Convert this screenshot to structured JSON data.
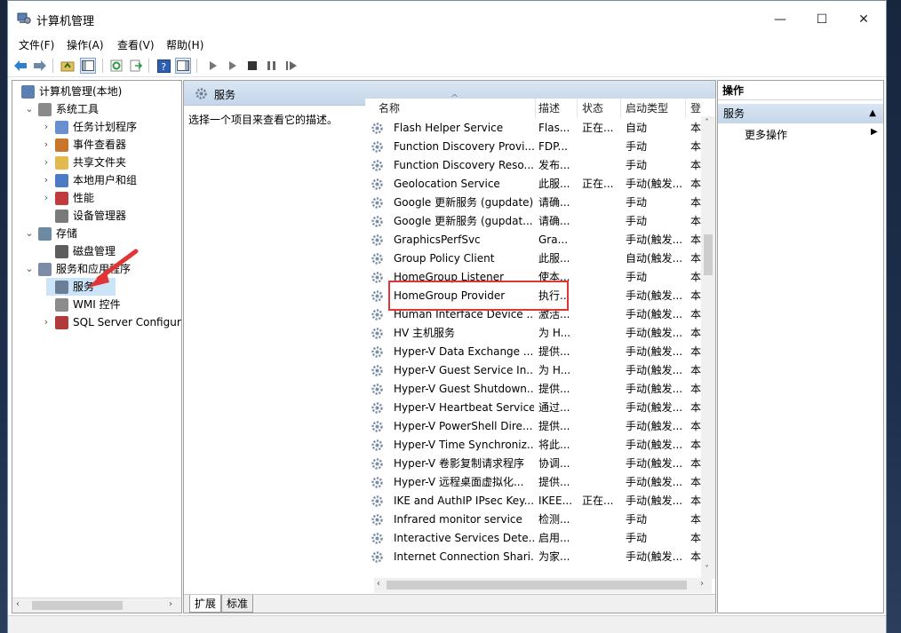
{
  "window": {
    "title": "计算机管理",
    "minimize": "—",
    "maximize": "☐",
    "close": "✕"
  },
  "menu": [
    "文件(F)",
    "操作(A)",
    "查看(V)",
    "帮助(H)"
  ],
  "tree": [
    {
      "label": "计算机管理(本地)",
      "icon": "computer-icon",
      "level": 0,
      "twisty": ""
    },
    {
      "label": "系统工具",
      "icon": "tools-icon",
      "level": 1,
      "twisty": "⌄"
    },
    {
      "label": "任务计划程序",
      "icon": "task-scheduler-icon",
      "level": 2,
      "twisty": "›"
    },
    {
      "label": "事件查看器",
      "icon": "event-viewer-icon",
      "level": 2,
      "twisty": "›"
    },
    {
      "label": "共享文件夹",
      "icon": "shared-folder-icon",
      "level": 2,
      "twisty": "›"
    },
    {
      "label": "本地用户和组",
      "icon": "users-icon",
      "level": 2,
      "twisty": "›"
    },
    {
      "label": "性能",
      "icon": "performance-icon",
      "level": 2,
      "twisty": "›"
    },
    {
      "label": "设备管理器",
      "icon": "device-manager-icon",
      "level": 2,
      "twisty": ""
    },
    {
      "label": "存储",
      "icon": "storage-icon",
      "level": 1,
      "twisty": "⌄"
    },
    {
      "label": "磁盘管理",
      "icon": "disk-icon",
      "level": 2,
      "twisty": ""
    },
    {
      "label": "服务和应用程序",
      "icon": "services-apps-icon",
      "level": 1,
      "twisty": "⌄"
    },
    {
      "label": "服务",
      "icon": "gear-icon",
      "level": 2,
      "twisty": "",
      "selected": true
    },
    {
      "label": "WMI 控件",
      "icon": "wmi-icon",
      "level": 2,
      "twisty": ""
    },
    {
      "label": "SQL Server Configura",
      "icon": "sql-icon",
      "level": 2,
      "twisty": "›"
    }
  ],
  "middle": {
    "header": "服务",
    "description_prompt": "选择一个项目来查看它的描述。",
    "columns": [
      "名称",
      "描述",
      "状态",
      "启动类型",
      "登"
    ],
    "rows": [
      [
        "Flash Helper Service",
        "Flas...",
        "正在...",
        "自动",
        "本"
      ],
      [
        "Function Discovery Provi...",
        "FDP...",
        "",
        "手动",
        "本"
      ],
      [
        "Function Discovery Reso...",
        "发布...",
        "",
        "手动",
        "本"
      ],
      [
        "Geolocation Service",
        "此服...",
        "正在...",
        "手动(触发...",
        "本"
      ],
      [
        "Google 更新服务 (gupdate)",
        "请确...",
        "",
        "手动",
        "本"
      ],
      [
        "Google 更新服务 (gupdat...",
        "请确...",
        "",
        "手动",
        "本"
      ],
      [
        "GraphicsPerfSvc",
        "Gra...",
        "",
        "手动(触发...",
        "本"
      ],
      [
        "Group Policy Client",
        "此服...",
        "",
        "自动(触发...",
        "本"
      ],
      [
        "HomeGroup Listener",
        "使本...",
        "",
        "手动",
        "本"
      ],
      [
        "HomeGroup Provider",
        "执行...",
        "",
        "手动(触发...",
        "本"
      ],
      [
        "Human Interface Device ...",
        "激活...",
        "",
        "手动(触发...",
        "本"
      ],
      [
        "HV 主机服务",
        "为 H...",
        "",
        "手动(触发...",
        "本"
      ],
      [
        "Hyper-V Data Exchange ...",
        "提供...",
        "",
        "手动(触发...",
        "本"
      ],
      [
        "Hyper-V Guest Service In...",
        "为 H...",
        "",
        "手动(触发...",
        "本"
      ],
      [
        "Hyper-V Guest Shutdown...",
        "提供...",
        "",
        "手动(触发...",
        "本"
      ],
      [
        "Hyper-V Heartbeat Service",
        "通过...",
        "",
        "手动(触发...",
        "本"
      ],
      [
        "Hyper-V PowerShell Dire...",
        "提供...",
        "",
        "手动(触发...",
        "本"
      ],
      [
        "Hyper-V Time Synchroniz...",
        "将此...",
        "",
        "手动(触发...",
        "本"
      ],
      [
        "Hyper-V 卷影复制请求程序",
        "协调...",
        "",
        "手动(触发...",
        "本"
      ],
      [
        "Hyper-V 远程桌面虚拟化...",
        "提供...",
        "",
        "手动(触发...",
        "本"
      ],
      [
        "IKE and AuthIP IPsec Key...",
        "IKEE...",
        "正在...",
        "手动(触发...",
        "本"
      ],
      [
        "Infrared monitor service",
        "检测...",
        "",
        "手动",
        "本"
      ],
      [
        "Interactive Services Dete...",
        "启用...",
        "",
        "手动",
        "本"
      ],
      [
        "Internet Connection Shari...",
        "为家...",
        "",
        "手动(触发...",
        "本"
      ]
    ],
    "tabs": [
      "扩展",
      "标准"
    ]
  },
  "actions": {
    "header": "操作",
    "section": "服务",
    "more": "更多操作"
  },
  "colors": {
    "selection": "#cce4f7",
    "header_gradient": "#c4d6ea",
    "highlight_box": "#e23434"
  }
}
